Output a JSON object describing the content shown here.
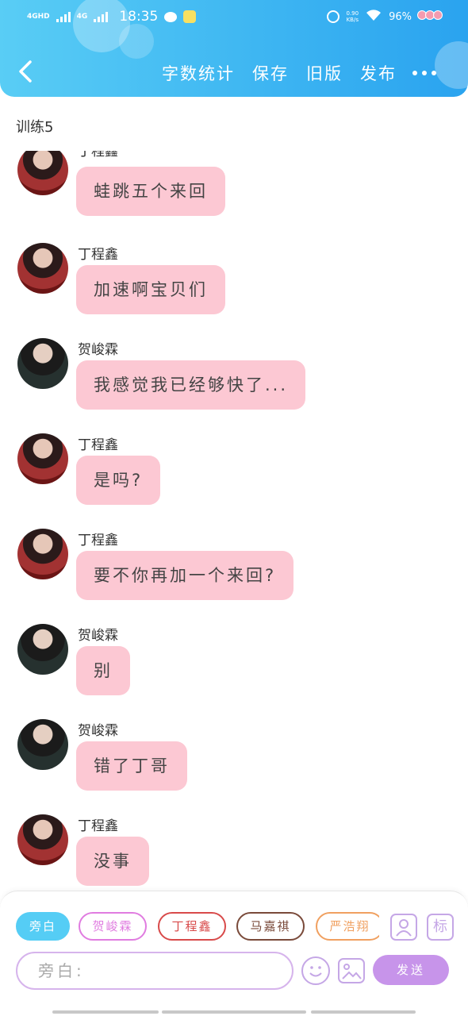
{
  "status_bar": {
    "network": "4GHD",
    "network2": "4G",
    "time": "18:35",
    "speed": "0.90",
    "speed_unit": "KB/s",
    "battery": "96%"
  },
  "header": {
    "actions": [
      "字数统计",
      "保存",
      "旧版",
      "发布"
    ]
  },
  "scene": {
    "title": "训练5"
  },
  "messages": [
    {
      "sender": "丁程鑫",
      "avatar": "ding",
      "text": "蛙跳五个来回"
    },
    {
      "sender": "丁程鑫",
      "avatar": "ding",
      "text": "加速啊宝贝们"
    },
    {
      "sender": "贺峻霖",
      "avatar": "he",
      "text": "我感觉我已经够快了..."
    },
    {
      "sender": "丁程鑫",
      "avatar": "ding",
      "text": "是吗?"
    },
    {
      "sender": "丁程鑫",
      "avatar": "ding",
      "text": "要不你再加一个来回?"
    },
    {
      "sender": "贺峻霖",
      "avatar": "he",
      "text": "别"
    },
    {
      "sender": "贺峻霖",
      "avatar": "he",
      "text": "错了丁哥"
    },
    {
      "sender": "丁程鑫",
      "avatar": "ding",
      "text": "没事"
    }
  ],
  "roles": [
    {
      "label": "旁白",
      "color": "#55cdf5",
      "active": true
    },
    {
      "label": "贺峻霖",
      "color": "#e07ce0",
      "active": false
    },
    {
      "label": "丁程鑫",
      "color": "#d84a4a",
      "active": false
    },
    {
      "label": "马嘉祺",
      "color": "#7a4a3a",
      "active": false
    },
    {
      "label": "严浩翔",
      "color": "#f0a060",
      "active": false
    }
  ],
  "tools": {
    "person_icon": "person-icon",
    "tag_label": "标"
  },
  "input": {
    "placeholder": "旁白:"
  },
  "send_label": "发送"
}
